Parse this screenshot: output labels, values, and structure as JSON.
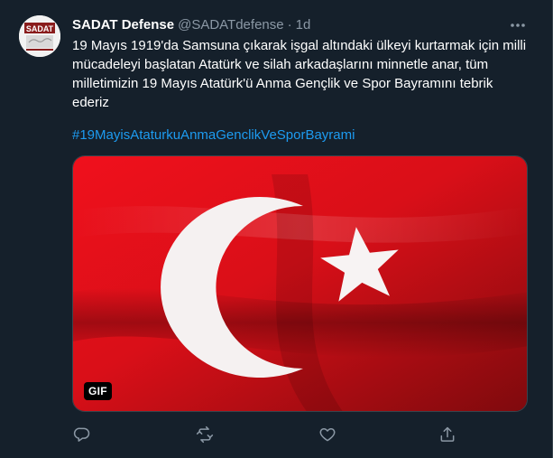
{
  "tweet": {
    "display_name": "SADAT Defense",
    "handle": "@SADATdefense",
    "separator": "·",
    "time": "1d",
    "text": "19 Mayıs 1919'da Samsuna çıkarak işgal altındaki ülkeyi kurtarmak için milli mücadeleyi başlatan Atatürk ve silah arkadaşlarını minnetle anar, tüm milletimizin 19 Mayıs Atatürk'ü Anma Gençlik ve Spor Bayramını tebrik ederiz",
    "hashtag": "#19MayisAtaturkuAnmaGenclikVeSporBayrami"
  },
  "avatar": {
    "logo_text": "SADAT"
  },
  "media": {
    "badge": "GIF",
    "flag_color": "#d7141c"
  },
  "icons": {
    "more": "more-dots-icon",
    "reply": "reply-icon",
    "retweet": "retweet-icon",
    "like": "heart-icon",
    "share": "share-icon"
  },
  "colors": {
    "background": "#15202b",
    "text": "#ffffff",
    "secondary": "#8b98a5",
    "accent": "#1d9bf0"
  }
}
